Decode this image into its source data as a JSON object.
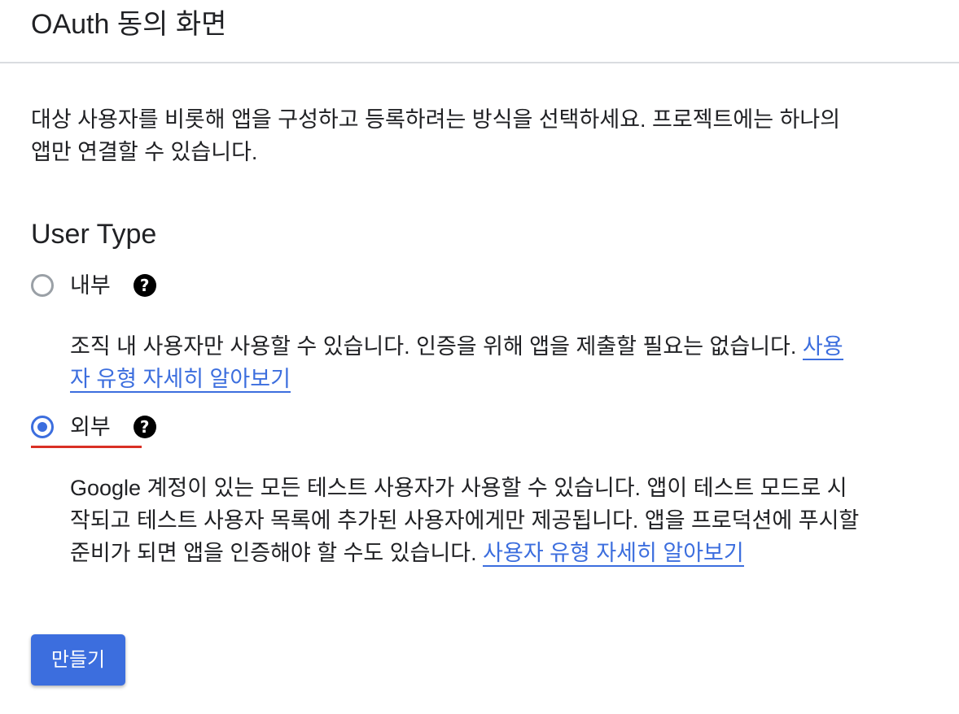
{
  "header": {
    "title": "OAuth 동의 화면"
  },
  "intro": {
    "text": "대상 사용자를 비롯해 앱을 구성하고 등록하려는 방식을 선택하세요. 프로젝트에는 하나의 앱만 연결할 수 있습니다."
  },
  "user_type": {
    "title": "User Type",
    "options": [
      {
        "label": "내부",
        "checked": false,
        "description": "조직 내 사용자만 사용할 수 있습니다. 인증을 위해 앱을 제출할 필요는 없습니다. ",
        "link_text": "사용자 유형 자세히 알아보기",
        "help_icon": "help-icon"
      },
      {
        "label": "외부",
        "checked": true,
        "description": "Google 계정이 있는 모든 테스트 사용자가 사용할 수 있습니다. 앱이 테스트 모드로 시작되고 테스트 사용자 목록에 추가된 사용자에게만 제공됩니다. 앱을 프로덕션에 푸시할 준비가 되면 앱을 인증해야 할 수도 있습니다. ",
        "link_text": "사용자 유형 자세히 알아보기",
        "help_icon": "help-icon"
      }
    ]
  },
  "actions": {
    "create_label": "만들기"
  },
  "colors": {
    "accent": "#3c6ede",
    "focus_underline": "#d93025",
    "divider": "#dadce0",
    "text": "#202124"
  }
}
